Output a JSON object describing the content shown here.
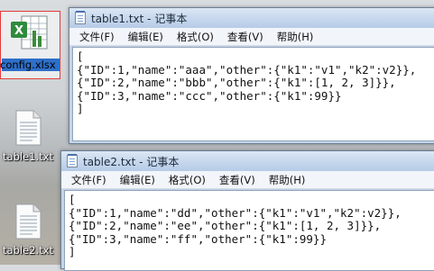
{
  "desktop": {
    "icons": [
      {
        "label": "config.xlsx",
        "type": "xlsx",
        "selected": true
      },
      {
        "label": "table1.txt",
        "type": "txt"
      },
      {
        "label": "table2.txt",
        "type": "txt"
      }
    ]
  },
  "windows": [
    {
      "title": "table1.txt - 记事本",
      "menu": [
        "文件(F)",
        "编辑(E)",
        "格式(O)",
        "查看(V)",
        "帮助(H)"
      ],
      "lines": [
        "[",
        "{\"ID\":1,\"name\":\"aaa\",\"other\":{\"k1\":\"v1\",\"k2\":v2}},",
        "{\"ID\":2,\"name\":\"bbb\",\"other\":{\"k1\":[1, 2, 3]}},",
        "{\"ID\":3,\"name\":\"ccc\",\"other\":{\"k1\":99}}",
        "]"
      ]
    },
    {
      "title": "table2.txt - 记事本",
      "menu": [
        "文件(F)",
        "编辑(E)",
        "格式(O)",
        "查看(V)",
        "帮助(H)"
      ],
      "lines": [
        "[",
        "{\"ID\":1,\"name\":\"dd\",\"other\":{\"k1\":\"v1\",\"k2\":v2}},",
        "{\"ID\":2,\"name\":\"ee\",\"other\":{\"k1\":[1, 2, 3]}},",
        "{\"ID\":3,\"name\":\"ff\",\"other\":{\"k1\":99}}",
        "]"
      ]
    }
  ]
}
